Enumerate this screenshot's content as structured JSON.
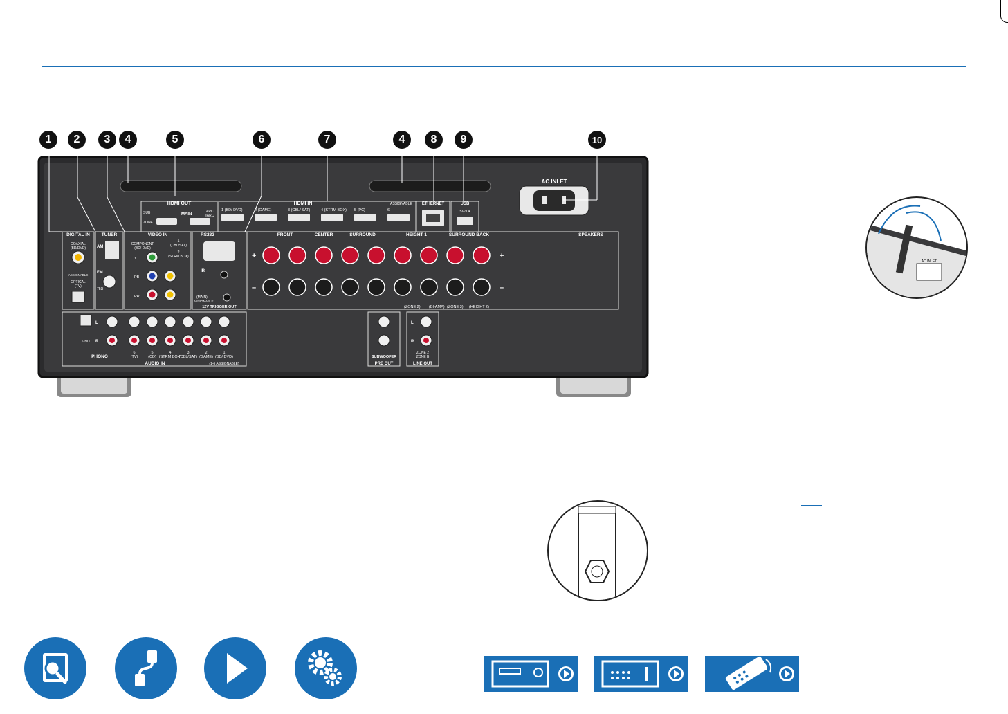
{
  "callouts": [
    "1",
    "2",
    "3",
    "4",
    "5",
    "6",
    "7",
    "4",
    "8",
    "9",
    "10"
  ],
  "panel_labels": {
    "digital_in": "DIGITAL IN",
    "coaxial": "COAXIAL",
    "coaxial_sub": "(BD/DVD)",
    "optical": "OPTICAL",
    "optical_sub": "(TV)",
    "assignable": "ASSIGNABLE",
    "tuner": "TUNER",
    "am": "AM",
    "fm": "FM",
    "ohm": "75Ω",
    "video_in": "VIDEO     IN",
    "component": "COMPONENT",
    "component_sub": "(BD/ DVD)",
    "y": "Y",
    "pb": "PB",
    "pr": "PR",
    "cbl_sat": "(CBL/SAT)",
    "strm_box": "(STRM BOX)",
    "v1": "1",
    "v2": "2",
    "hdmi_out": "HDMI OUT",
    "sub": "SUB",
    "zone": "ZONE",
    "main": "MAIN",
    "arc": "ARC",
    "earc": "eARC",
    "hdmi_in": "HDMI IN",
    "hdmi_in_1": "1 (BD/ DVD)",
    "hdmi_in_2": "2 (GAME)",
    "hdmi_in_3": "3 (CBL/ SAT)",
    "hdmi_in_4": "4 (STRM BOX)",
    "hdmi_in_5": "5 (PC)",
    "hdmi_in_6": "6",
    "hdmi_assignable": "ASSIGNABLE",
    "ethernet": "ETHERNET",
    "usb": "USB",
    "usb_rating": "5V/1A",
    "ac_inlet": "AC INLET",
    "rs232": "RS232",
    "ir": "IR",
    "main_trigger": "(MAIN)",
    "trigger_assignable": "ASSIGNABLE",
    "trigger_out": "12V TRIGGER OUT",
    "front": "FRONT",
    "center": "CENTER",
    "surround": "SURROUND",
    "height1": "HEIGHT 1",
    "surround_back": "SURROUND BACK",
    "speakers": "SPEAKERS",
    "r": "R",
    "l": "L",
    "plus": "+",
    "minus": "–",
    "zone2": "(ZONE 2)",
    "biamp": "(BI-AMP)",
    "zone3": "(ZONE 3)",
    "height2": "(HEIGHT 2)",
    "gnd": "GND",
    "phono": "PHONO",
    "audio_in": "AUDIO IN",
    "audio_assignable": "(1-6 ASSIGNABLE)",
    "a6": "6",
    "a6s": "(TV)",
    "a5": "5",
    "a5s": "(CD)",
    "a4": "4",
    "a4s": "(STRM BOX)",
    "a3": "3",
    "a3s": "(CBL/SAT)",
    "a2": "2",
    "a2s": "(GAME)",
    "a1": "1",
    "a1s": "(BD/ DVD)",
    "subwoofer": "SUBWOOFER",
    "pre_out": "PRE OUT",
    "zone2_lo": "ZONE 2",
    "zone_b": "ZONE B",
    "line_out": "LINE OUT",
    "inset_ac": "AC INLET"
  },
  "nav": {
    "circle_icons": [
      "book-search-icon",
      "cable-icon",
      "play-icon",
      "gears-icon"
    ],
    "square_icons": [
      "front-panel-icon",
      "rear-panel-icon",
      "remote-icon"
    ]
  },
  "colors": {
    "accent": "#1a6fb6",
    "panel": "#3a3a3c",
    "terminal_red": "#c8102e"
  }
}
